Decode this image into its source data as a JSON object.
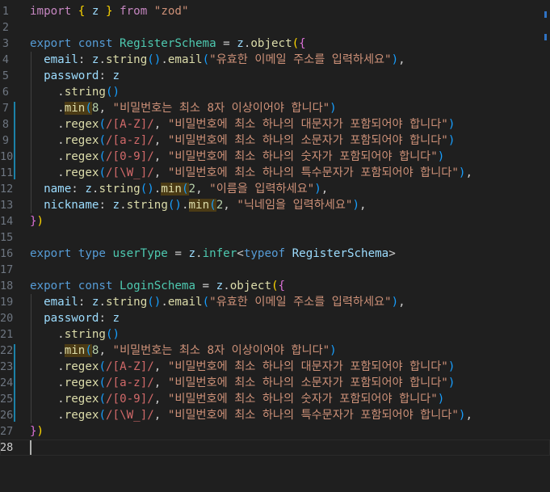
{
  "lines": [
    [
      [
        "ki",
        "import "
      ],
      [
        "b1",
        "{"
      ],
      [
        "p",
        " "
      ],
      [
        "v",
        "z"
      ],
      [
        "p",
        " "
      ],
      [
        "b1",
        "}"
      ],
      [
        "ki",
        " from "
      ],
      [
        "s",
        "\"zod\""
      ]
    ],
    [],
    [
      [
        "k",
        "export const "
      ],
      [
        "c",
        "RegisterSchema"
      ],
      [
        "p",
        " = "
      ],
      [
        "v",
        "z"
      ],
      [
        "p",
        "."
      ],
      [
        "f",
        "object"
      ],
      [
        "b1",
        "("
      ],
      [
        "b2",
        "{"
      ]
    ],
    [
      [
        "p",
        "  "
      ],
      [
        "v",
        "email"
      ],
      [
        "p",
        ": "
      ],
      [
        "v",
        "z"
      ],
      [
        "p",
        "."
      ],
      [
        "f",
        "string"
      ],
      [
        "b3",
        "()"
      ],
      [
        "p",
        "."
      ],
      [
        "f",
        "email"
      ],
      [
        "b3",
        "("
      ],
      [
        "s",
        "\"유효한 이메일 주소를 입력하세요\""
      ],
      [
        "b3",
        ")"
      ],
      [
        "p",
        ","
      ]
    ],
    [
      [
        "p",
        "  "
      ],
      [
        "v",
        "password"
      ],
      [
        "p",
        ": "
      ],
      [
        "v",
        "z"
      ]
    ],
    [
      [
        "p",
        "    ."
      ],
      [
        "f",
        "string"
      ],
      [
        "b3",
        "()"
      ]
    ],
    [
      [
        "p",
        "    ."
      ],
      [
        "f hl",
        "min"
      ],
      [
        "b3 hl",
        "("
      ],
      [
        "n",
        "8"
      ],
      [
        "p",
        ", "
      ],
      [
        "s",
        "\"비밀번호는 최소 8자 이상이어야 합니다\""
      ],
      [
        "b3",
        ")"
      ]
    ],
    [
      [
        "p",
        "    ."
      ],
      [
        "f",
        "regex"
      ],
      [
        "b3",
        "("
      ],
      [
        "r",
        "/[A-Z]/"
      ],
      [
        "p",
        ", "
      ],
      [
        "s",
        "\"비밀번호에 최소 하나의 대문자가 포함되어야 합니다\""
      ],
      [
        "b3",
        ")"
      ]
    ],
    [
      [
        "p",
        "    ."
      ],
      [
        "f",
        "regex"
      ],
      [
        "b3",
        "("
      ],
      [
        "r",
        "/[a-z]/"
      ],
      [
        "p",
        ", "
      ],
      [
        "s",
        "\"비밀번호에 최소 하나의 소문자가 포함되어야 합니다\""
      ],
      [
        "b3",
        ")"
      ]
    ],
    [
      [
        "p",
        "    ."
      ],
      [
        "f",
        "regex"
      ],
      [
        "b3",
        "("
      ],
      [
        "r",
        "/[0-9]/"
      ],
      [
        "p",
        ", "
      ],
      [
        "s",
        "\"비밀번호에 최소 하나의 숫자가 포함되어야 합니다\""
      ],
      [
        "b3",
        ")"
      ]
    ],
    [
      [
        "p",
        "    ."
      ],
      [
        "f",
        "regex"
      ],
      [
        "b3",
        "("
      ],
      [
        "r",
        "/[\\W_]/"
      ],
      [
        "p",
        ", "
      ],
      [
        "s",
        "\"비밀번호에 최소 하나의 특수문자가 포함되어야 합니다\""
      ],
      [
        "b3",
        ")"
      ],
      [
        "p",
        ","
      ]
    ],
    [
      [
        "p",
        "  "
      ],
      [
        "v",
        "name"
      ],
      [
        "p",
        ": "
      ],
      [
        "v",
        "z"
      ],
      [
        "p",
        "."
      ],
      [
        "f",
        "string"
      ],
      [
        "b3",
        "()"
      ],
      [
        "p",
        "."
      ],
      [
        "f hl",
        "min"
      ],
      [
        "b3 hl",
        "("
      ],
      [
        "n",
        "2"
      ],
      [
        "p",
        ", "
      ],
      [
        "s",
        "\"이름을 입력하세요\""
      ],
      [
        "b3",
        ")"
      ],
      [
        "p",
        ","
      ]
    ],
    [
      [
        "p",
        "  "
      ],
      [
        "v",
        "nickname"
      ],
      [
        "p",
        ": "
      ],
      [
        "v",
        "z"
      ],
      [
        "p",
        "."
      ],
      [
        "f",
        "string"
      ],
      [
        "b3",
        "()"
      ],
      [
        "p",
        "."
      ],
      [
        "f hl",
        "min"
      ],
      [
        "b3 hl",
        "("
      ],
      [
        "n",
        "2"
      ],
      [
        "p",
        ", "
      ],
      [
        "s",
        "\"닉네임을 입력하세요\""
      ],
      [
        "b3",
        ")"
      ],
      [
        "p",
        ","
      ]
    ],
    [
      [
        "b2",
        "}"
      ],
      [
        "b1",
        ")"
      ]
    ],
    [],
    [
      [
        "k",
        "export type "
      ],
      [
        "c",
        "userType"
      ],
      [
        "p",
        " = "
      ],
      [
        "v",
        "z"
      ],
      [
        "p",
        "."
      ],
      [
        "c",
        "infer"
      ],
      [
        "p",
        "<"
      ],
      [
        "k",
        "typeof "
      ],
      [
        "v",
        "RegisterSchema"
      ],
      [
        "p",
        ">"
      ]
    ],
    [],
    [
      [
        "k",
        "export const "
      ],
      [
        "c",
        "LoginSchema"
      ],
      [
        "p",
        " = "
      ],
      [
        "v",
        "z"
      ],
      [
        "p",
        "."
      ],
      [
        "f",
        "object"
      ],
      [
        "b1",
        "("
      ],
      [
        "b2",
        "{"
      ]
    ],
    [
      [
        "p",
        "  "
      ],
      [
        "v",
        "email"
      ],
      [
        "p",
        ": "
      ],
      [
        "v",
        "z"
      ],
      [
        "p",
        "."
      ],
      [
        "f",
        "string"
      ],
      [
        "b3",
        "()"
      ],
      [
        "p",
        "."
      ],
      [
        "f",
        "email"
      ],
      [
        "b3",
        "("
      ],
      [
        "s",
        "\"유효한 이메일 주소를 입력하세요\""
      ],
      [
        "b3",
        ")"
      ],
      [
        "p",
        ","
      ]
    ],
    [
      [
        "p",
        "  "
      ],
      [
        "v",
        "password"
      ],
      [
        "p",
        ": "
      ],
      [
        "v",
        "z"
      ]
    ],
    [
      [
        "p",
        "    ."
      ],
      [
        "f",
        "string"
      ],
      [
        "b3",
        "()"
      ]
    ],
    [
      [
        "p",
        "    ."
      ],
      [
        "f hl",
        "min"
      ],
      [
        "b3 hl",
        "("
      ],
      [
        "n",
        "8"
      ],
      [
        "p",
        ", "
      ],
      [
        "s",
        "\"비밀번호는 최소 8자 이상이어야 합니다\""
      ],
      [
        "b3",
        ")"
      ]
    ],
    [
      [
        "p",
        "    ."
      ],
      [
        "f",
        "regex"
      ],
      [
        "b3",
        "("
      ],
      [
        "r",
        "/[A-Z]/"
      ],
      [
        "p",
        ", "
      ],
      [
        "s",
        "\"비밀번호에 최소 하나의 대문자가 포함되어야 합니다\""
      ],
      [
        "b3",
        ")"
      ]
    ],
    [
      [
        "p",
        "    ."
      ],
      [
        "f",
        "regex"
      ],
      [
        "b3",
        "("
      ],
      [
        "r",
        "/[a-z]/"
      ],
      [
        "p",
        ", "
      ],
      [
        "s",
        "\"비밀번호에 최소 하나의 소문자가 포함되어야 합니다\""
      ],
      [
        "b3",
        ")"
      ]
    ],
    [
      [
        "p",
        "    ."
      ],
      [
        "f",
        "regex"
      ],
      [
        "b3",
        "("
      ],
      [
        "r",
        "/[0-9]/"
      ],
      [
        "p",
        ", "
      ],
      [
        "s",
        "\"비밀번호에 최소 하나의 숫자가 포함되어야 합니다\""
      ],
      [
        "b3",
        ")"
      ]
    ],
    [
      [
        "p",
        "    ."
      ],
      [
        "f",
        "regex"
      ],
      [
        "b3",
        "("
      ],
      [
        "r",
        "/[\\W_]/"
      ],
      [
        "p",
        ", "
      ],
      [
        "s",
        "\"비밀번호에 최소 하나의 특수문자가 포함되어야 합니다\""
      ],
      [
        "b3",
        ")"
      ],
      [
        "p",
        ","
      ]
    ],
    [
      [
        "b2",
        "}"
      ],
      [
        "b1",
        ")"
      ]
    ],
    []
  ],
  "line_numbers": [
    "1",
    "2",
    "3",
    "4",
    "5",
    "6",
    "7",
    "8",
    "9",
    "10",
    "11",
    "12",
    "13",
    "14",
    "15",
    "16",
    "17",
    "18",
    "19",
    "20",
    "21",
    "22",
    "23",
    "24",
    "25",
    "26",
    "27",
    "28"
  ],
  "active_line": 28,
  "theme_colors": {
    "background": "#1f1f1f",
    "keyword": "#569cd6",
    "control_keyword": "#c586c0",
    "function": "#dcdcaa",
    "variable": "#9cdcfe",
    "type": "#4ec9b0",
    "string": "#ce9178",
    "regex": "#d16969",
    "number": "#b5cea8",
    "modified_line_marker": "#1b81a8"
  }
}
